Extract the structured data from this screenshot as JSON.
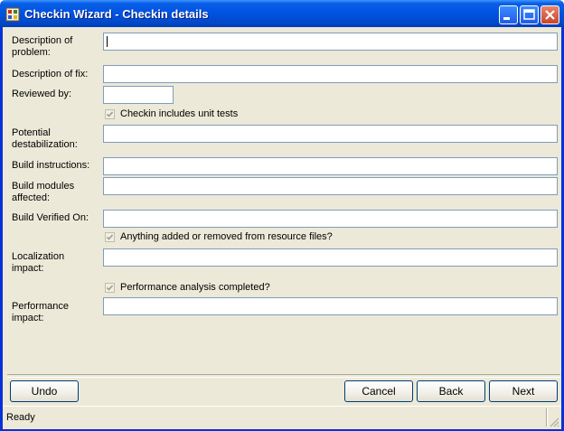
{
  "window": {
    "title": "Checkin Wizard - Checkin details"
  },
  "form": {
    "description_problem_label": "Description of problem:",
    "description_fix_label": "Description of fix:",
    "reviewed_by_label": "Reviewed by:",
    "unit_tests_label": "Checkin includes unit tests",
    "potential_destabilization_label": "Potential destabilization:",
    "build_instructions_label": "Build instructions:",
    "build_modules_label": "Build modules affected:",
    "build_verified_label": "Build Verified On:",
    "resource_files_label": "Anything added or removed from resource files?",
    "localization_label": "Localization impact:",
    "performance_analysis_label": "Performance analysis completed?",
    "performance_impact_label": "Performance impact:",
    "description_problem_value": "",
    "description_fix_value": "",
    "reviewed_by_value": "",
    "potential_destabilization_value": "",
    "build_instructions_value": "",
    "build_modules_value": "",
    "build_verified_value": "",
    "localization_value": "",
    "performance_impact_value": "",
    "unit_tests_checked": true,
    "resource_files_checked": true,
    "performance_analysis_checked": true
  },
  "buttons": {
    "undo": "Undo",
    "cancel": "Cancel",
    "back": "Back",
    "next": "Next"
  },
  "status": {
    "text": "Ready"
  },
  "colors": {
    "titlebar": "#0054E3",
    "window_bg": "#ECE9D8",
    "close_button": "#C9452A"
  }
}
